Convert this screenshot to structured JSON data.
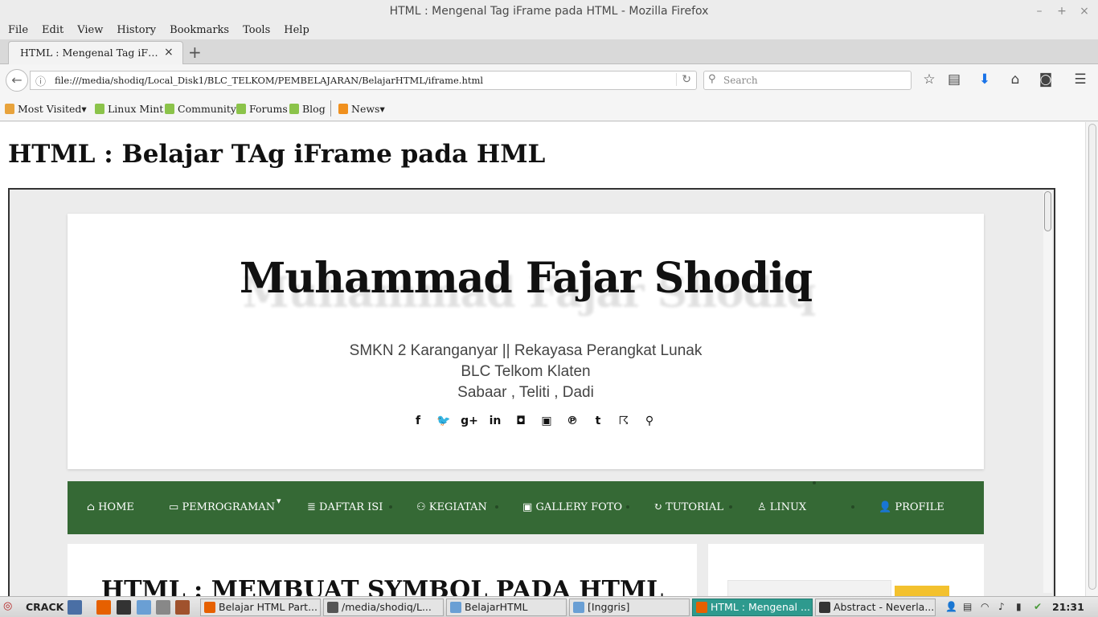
{
  "window": {
    "title": "HTML : Mengenal Tag iFrame pada HTML - Mozilla Firefox",
    "minimize": "–",
    "maximize": "+",
    "close": "×"
  },
  "menubar": [
    "File",
    "Edit",
    "View",
    "History",
    "Bookmarks",
    "Tools",
    "Help"
  ],
  "tabs": {
    "active_label": "HTML : Mengenal Tag iFram…",
    "close": "×",
    "new_tab": "+"
  },
  "navbar": {
    "back": "←",
    "info": "ⓘ",
    "url": "file:///media/shodiq/Local_Disk1/BLC_TELKOM/PEMBELAJARAN/BelajarHTML/iframe.html",
    "reload": "↻",
    "search_placeholder": "Search",
    "search_glyph": "⚲",
    "icons": {
      "bookmark": "☆",
      "reading_list": "▤",
      "downloads": "⬇",
      "home": "⌂",
      "pocket": "◙",
      "menu": "☰"
    }
  },
  "bookmarks": {
    "items": [
      "Most Visited",
      "Linux Mint",
      "Community",
      "Forums",
      "Blog",
      "News"
    ],
    "dropdown": "▾"
  },
  "page": {
    "heading": "HTML : Belajar TAg iFrame pada HML"
  },
  "embedded_site": {
    "title": "Muhammad Fajar Shodiq",
    "tagline": [
      "SMKN 2 Karanganyar || Rekayasa Perangkat Lunak",
      "BLC Telkom Klaten",
      "Sabaar , Teliti , Dadi"
    ],
    "social_icons": [
      {
        "name": "facebook-icon",
        "glyph": "f"
      },
      {
        "name": "twitter-icon",
        "glyph": "🐦"
      },
      {
        "name": "google-plus-icon",
        "glyph": "g+"
      },
      {
        "name": "linkedin-icon",
        "glyph": "in"
      },
      {
        "name": "instagram-icon",
        "glyph": "◘"
      },
      {
        "name": "youtube-icon",
        "glyph": "▣"
      },
      {
        "name": "pinterest-icon",
        "glyph": "℗"
      },
      {
        "name": "tumblr-icon",
        "glyph": "t"
      },
      {
        "name": "rss-icon",
        "glyph": "☈"
      },
      {
        "name": "search-icon",
        "glyph": "⚲"
      }
    ],
    "nav": [
      {
        "icon": "⌂",
        "label": "HOME"
      },
      {
        "icon": "▭",
        "label": "PEMROGRAMAN",
        "caret": "▾"
      },
      {
        "icon": "≣",
        "label": "DAFTAR ISI"
      },
      {
        "icon": "⚇",
        "label": "KEGIATAN"
      },
      {
        "icon": "▣",
        "label": "GALLERY FOTO"
      },
      {
        "icon": "↻",
        "label": "TUTORIAL"
      },
      {
        "icon": "♙",
        "label": "LINUX"
      },
      {
        "icon": "👤",
        "label": "PROFILE"
      }
    ],
    "post_title": "HTML : MEMBUAT SYMBOL PADA HTML",
    "nav_color": "#356935",
    "button_color": "#f3c12e"
  },
  "taskbar": {
    "start_label": "CRACK",
    "tasks": [
      {
        "label": "Belajar HTML Part...",
        "active": false
      },
      {
        "label": "/media/shodiq/L...",
        "active": false
      },
      {
        "label": "BelajarHTML",
        "active": false
      },
      {
        "label": "[Inggris]",
        "active": false
      },
      {
        "label": "HTML : Mengenal ...",
        "active": true
      },
      {
        "label": "Abstract - Neverla...",
        "active": false
      }
    ],
    "clock": "21:31",
    "active_color": "#2e9a8e"
  }
}
